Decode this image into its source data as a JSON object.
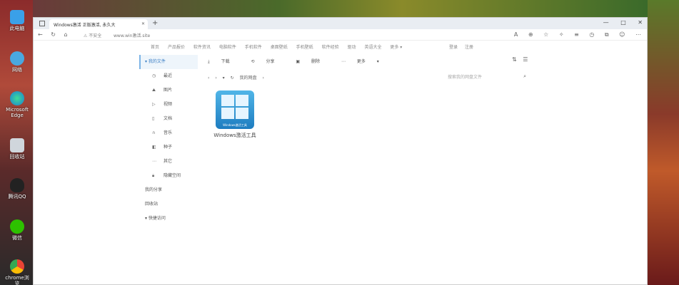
{
  "desktop": {
    "icons": [
      {
        "label": "此电脑"
      },
      {
        "label": "网络"
      },
      {
        "label": "Microsoft Edge"
      },
      {
        "label": "回收站"
      },
      {
        "label": "腾讯QQ"
      },
      {
        "label": "微信"
      },
      {
        "label": "chrome浏览"
      }
    ]
  },
  "browser": {
    "tab_title": "Windows激活 正版激活, 永久大",
    "url_warning": "不安全",
    "url": "www.win激活.site"
  },
  "site_nav": {
    "items": [
      "首页",
      "产品报价",
      "软件资讯",
      "电脑软件",
      "手机软件",
      "桌面壁纸",
      "手机壁纸",
      "软件经验",
      "驱动",
      "英语大全",
      "更多 ▾"
    ],
    "login": "登录",
    "register": "注册"
  },
  "sidebar": {
    "my_files": "我的文件",
    "recent": "最近",
    "images": "图片",
    "videos": "视频",
    "docs": "文档",
    "music": "音乐",
    "torrent": "种子",
    "other": "其它",
    "hidden": "隐藏空间",
    "my_share": "我的分享",
    "recycle": "回收站",
    "quick_access": "快捷访问"
  },
  "toolbar": {
    "download": "下载",
    "share": "分享",
    "delete": "删除",
    "more": "更多"
  },
  "path": {
    "current": "我的网盘"
  },
  "search": {
    "placeholder": "搜索我的网盘文件"
  },
  "file": {
    "name": "Windows激活工具",
    "icon_caption": "Windows激活工具"
  }
}
